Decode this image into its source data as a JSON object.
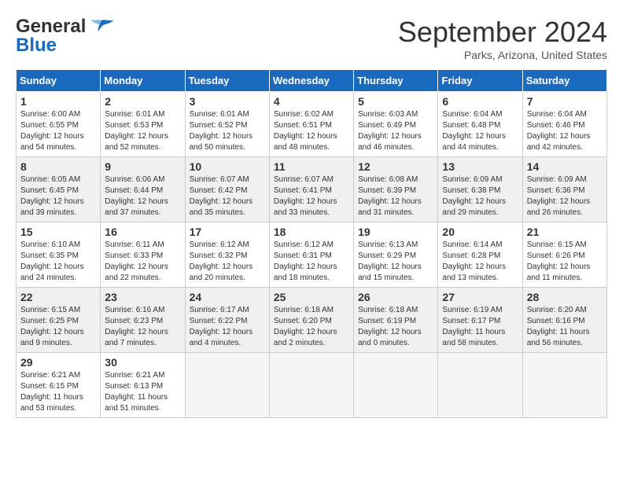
{
  "header": {
    "logo_line1": "General",
    "logo_line2": "Blue",
    "month": "September 2024",
    "location": "Parks, Arizona, United States"
  },
  "days_of_week": [
    "Sunday",
    "Monday",
    "Tuesday",
    "Wednesday",
    "Thursday",
    "Friday",
    "Saturday"
  ],
  "weeks": [
    [
      {
        "day": "1",
        "sunrise": "6:00 AM",
        "sunset": "6:55 PM",
        "daylight": "12 hours and 54 minutes."
      },
      {
        "day": "2",
        "sunrise": "6:01 AM",
        "sunset": "6:53 PM",
        "daylight": "12 hours and 52 minutes."
      },
      {
        "day": "3",
        "sunrise": "6:01 AM",
        "sunset": "6:52 PM",
        "daylight": "12 hours and 50 minutes."
      },
      {
        "day": "4",
        "sunrise": "6:02 AM",
        "sunset": "6:51 PM",
        "daylight": "12 hours and 48 minutes."
      },
      {
        "day": "5",
        "sunrise": "6:03 AM",
        "sunset": "6:49 PM",
        "daylight": "12 hours and 46 minutes."
      },
      {
        "day": "6",
        "sunrise": "6:04 AM",
        "sunset": "6:48 PM",
        "daylight": "12 hours and 44 minutes."
      },
      {
        "day": "7",
        "sunrise": "6:04 AM",
        "sunset": "6:46 PM",
        "daylight": "12 hours and 42 minutes."
      }
    ],
    [
      {
        "day": "8",
        "sunrise": "6:05 AM",
        "sunset": "6:45 PM",
        "daylight": "12 hours and 39 minutes."
      },
      {
        "day": "9",
        "sunrise": "6:06 AM",
        "sunset": "6:44 PM",
        "daylight": "12 hours and 37 minutes."
      },
      {
        "day": "10",
        "sunrise": "6:07 AM",
        "sunset": "6:42 PM",
        "daylight": "12 hours and 35 minutes."
      },
      {
        "day": "11",
        "sunrise": "6:07 AM",
        "sunset": "6:41 PM",
        "daylight": "12 hours and 33 minutes."
      },
      {
        "day": "12",
        "sunrise": "6:08 AM",
        "sunset": "6:39 PM",
        "daylight": "12 hours and 31 minutes."
      },
      {
        "day": "13",
        "sunrise": "6:09 AM",
        "sunset": "6:38 PM",
        "daylight": "12 hours and 29 minutes."
      },
      {
        "day": "14",
        "sunrise": "6:09 AM",
        "sunset": "6:36 PM",
        "daylight": "12 hours and 26 minutes."
      }
    ],
    [
      {
        "day": "15",
        "sunrise": "6:10 AM",
        "sunset": "6:35 PM",
        "daylight": "12 hours and 24 minutes."
      },
      {
        "day": "16",
        "sunrise": "6:11 AM",
        "sunset": "6:33 PM",
        "daylight": "12 hours and 22 minutes."
      },
      {
        "day": "17",
        "sunrise": "6:12 AM",
        "sunset": "6:32 PM",
        "daylight": "12 hours and 20 minutes."
      },
      {
        "day": "18",
        "sunrise": "6:12 AM",
        "sunset": "6:31 PM",
        "daylight": "12 hours and 18 minutes."
      },
      {
        "day": "19",
        "sunrise": "6:13 AM",
        "sunset": "6:29 PM",
        "daylight": "12 hours and 15 minutes."
      },
      {
        "day": "20",
        "sunrise": "6:14 AM",
        "sunset": "6:28 PM",
        "daylight": "12 hours and 13 minutes."
      },
      {
        "day": "21",
        "sunrise": "6:15 AM",
        "sunset": "6:26 PM",
        "daylight": "12 hours and 11 minutes."
      }
    ],
    [
      {
        "day": "22",
        "sunrise": "6:15 AM",
        "sunset": "6:25 PM",
        "daylight": "12 hours and 9 minutes."
      },
      {
        "day": "23",
        "sunrise": "6:16 AM",
        "sunset": "6:23 PM",
        "daylight": "12 hours and 7 minutes."
      },
      {
        "day": "24",
        "sunrise": "6:17 AM",
        "sunset": "6:22 PM",
        "daylight": "12 hours and 4 minutes."
      },
      {
        "day": "25",
        "sunrise": "6:18 AM",
        "sunset": "6:20 PM",
        "daylight": "12 hours and 2 minutes."
      },
      {
        "day": "26",
        "sunrise": "6:18 AM",
        "sunset": "6:19 PM",
        "daylight": "12 hours and 0 minutes."
      },
      {
        "day": "27",
        "sunrise": "6:19 AM",
        "sunset": "6:17 PM",
        "daylight": "11 hours and 58 minutes."
      },
      {
        "day": "28",
        "sunrise": "6:20 AM",
        "sunset": "6:16 PM",
        "daylight": "11 hours and 56 minutes."
      }
    ],
    [
      {
        "day": "29",
        "sunrise": "6:21 AM",
        "sunset": "6:15 PM",
        "daylight": "11 hours and 53 minutes."
      },
      {
        "day": "30",
        "sunrise": "6:21 AM",
        "sunset": "6:13 PM",
        "daylight": "11 hours and 51 minutes."
      },
      null,
      null,
      null,
      null,
      null
    ]
  ]
}
